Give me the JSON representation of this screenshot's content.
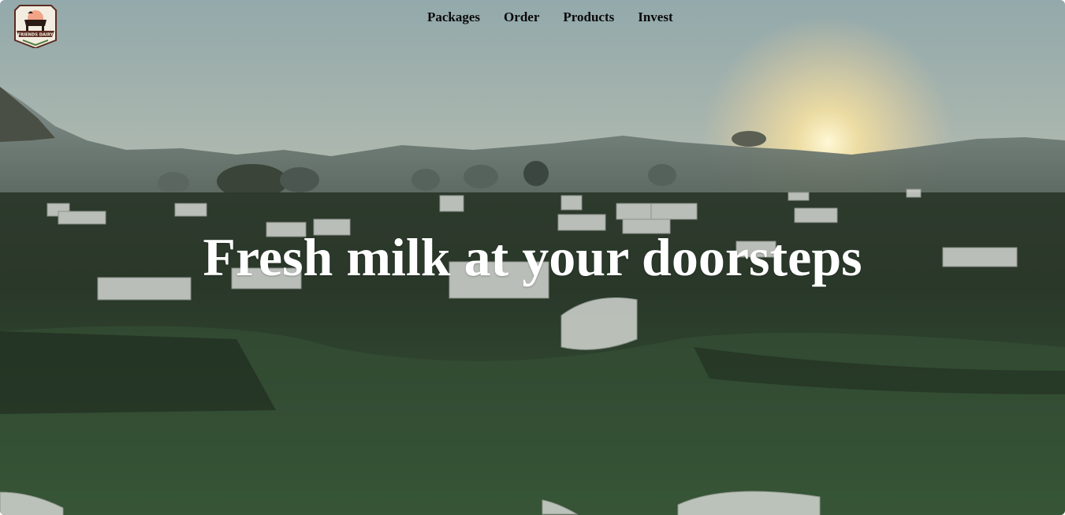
{
  "logo": {
    "text": "FRIENDS DAIRY"
  },
  "nav": {
    "items": [
      {
        "label": "Packages"
      },
      {
        "label": "Order"
      },
      {
        "label": "Products"
      },
      {
        "label": "Invest"
      }
    ]
  },
  "hero": {
    "title": "Fresh milk at your doorsteps"
  },
  "colors": {
    "sky_top": "#8aa6aa",
    "sunset_glow": "#f2d38a",
    "grass_dark": "#1f2d20",
    "grass_mid": "#3e5a3a",
    "logo_brand": "#5a2b22"
  }
}
